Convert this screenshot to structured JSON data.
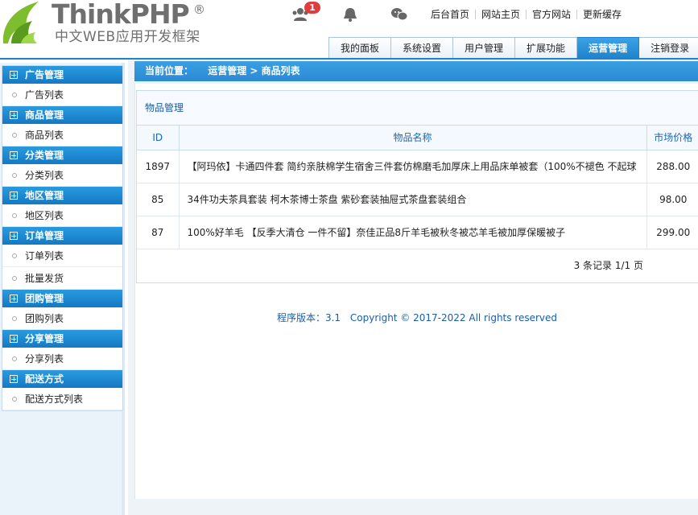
{
  "header": {
    "logo_text": "ThinkPHP",
    "logo_reg": "®",
    "logo_sub": "中文WEB应用开发框架",
    "notification_count": "1",
    "links": [
      "后台首页",
      "网站主页",
      "官方网站",
      "更新缓存"
    ]
  },
  "nav": {
    "tabs": [
      "我的面板",
      "系统设置",
      "用户管理",
      "扩展功能",
      "运营管理",
      "注销登录"
    ],
    "active_tab": "运营管理"
  },
  "sidebar": {
    "groups": [
      {
        "title": "广告管理",
        "items": [
          "广告列表"
        ]
      },
      {
        "title": "商品管理",
        "items": [
          "商品列表"
        ]
      },
      {
        "title": "分类管理",
        "items": [
          "分类列表"
        ]
      },
      {
        "title": "地区管理",
        "items": [
          "地区列表"
        ]
      },
      {
        "title": "订单管理",
        "items": [
          "订单列表",
          "批量发货"
        ]
      },
      {
        "title": "团购管理",
        "items": [
          "团购列表"
        ]
      },
      {
        "title": "分享管理",
        "items": [
          "分享列表"
        ]
      },
      {
        "title": "配送方式",
        "items": [
          "配送方式列表"
        ]
      }
    ]
  },
  "breadcrumb": {
    "label": "当前位置：",
    "path": "运营管理 > 商品列表"
  },
  "panel": {
    "title": "物品管理",
    "columns": [
      "ID",
      "物品名称",
      "市场价格"
    ],
    "rows": [
      {
        "id": "1897",
        "name": "【阿玛依】卡通四件套 简约亲肤棉学生宿舍三件套仿棉磨毛加厚床上用品床单被套（100%不褪色 不起球",
        "price": "288.00"
      },
      {
        "id": "85",
        "name": "34件功夫茶具套装 柯木茶博士茶盘 紫砂套装抽屉式茶盘套装组合",
        "price": "98.00"
      },
      {
        "id": "87",
        "name": "100%好羊毛 【反季大清仓 一件不留】奈佳正品8斤羊毛被秋冬被芯羊毛被加厚保暖被子",
        "price": "299.00"
      }
    ],
    "pager": "3 条记录 1/1 页"
  },
  "footer": {
    "version_label": "程序版本：3.1",
    "copyright": "Copyright © 2017-2022 All rights reserved"
  },
  "colors": {
    "accent": "#1f82cc",
    "sidebar_head": "#1479c2",
    "link_blue": "#1a5ea8",
    "badge": "#e23b3b"
  }
}
